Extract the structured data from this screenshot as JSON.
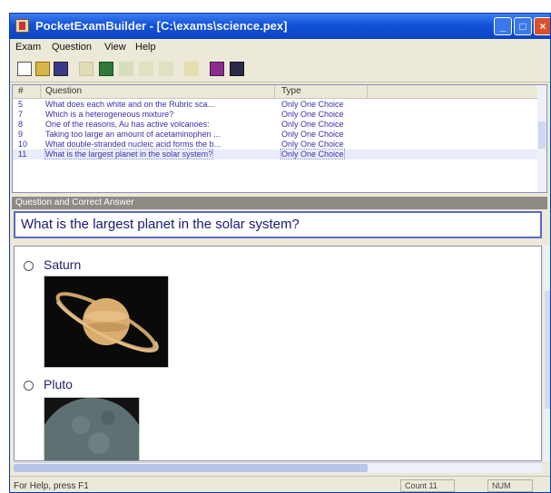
{
  "window": {
    "title": "PocketExamBuilder - [C:\\exams\\science.pex]",
    "controls": {
      "minimize": "_",
      "maximize": "□",
      "close": "×"
    }
  },
  "menu": [
    "Exam",
    "Question",
    "View",
    "Help"
  ],
  "toolbar": {
    "icons": [
      "new-icon",
      "open-icon",
      "save-icon",
      "cut-icon",
      "add-question-icon",
      "delete-question-icon",
      "move-up-icon",
      "move-down-icon",
      "edit-icon",
      "preview-icon",
      "help-icon"
    ]
  },
  "question_list": {
    "columns": [
      "#",
      "Question",
      "Type"
    ],
    "rows": [
      {
        "num": "5",
        "question": "What does each white and on the Rubric sca...",
        "type": "Only One Choice"
      },
      {
        "num": "7",
        "question": "Which is a heterogeneous mixture?",
        "type": "Only One Choice"
      },
      {
        "num": "8",
        "question": "One of the reasons, Au has active volcanoes:",
        "type": "Only One Choice"
      },
      {
        "num": "9",
        "question": "Taking too large an amount of acetaminophen ...",
        "type": "Only One Choice"
      },
      {
        "num": "10",
        "question": "What double-stranded nucleic acid forms the b...",
        "type": "Only One Choice"
      },
      {
        "num": "11",
        "question": "What is the largest planet in the solar system?",
        "type": "Only One Choice"
      }
    ]
  },
  "qa_panel": {
    "header": "Question and Correct Answer",
    "question": "What is the largest planet in the solar system?",
    "answers": [
      {
        "label": "Saturn"
      },
      {
        "label": "Pluto"
      }
    ]
  },
  "status": {
    "help": "For Help, press F1",
    "count": "Count 11",
    "num": "NUM"
  },
  "colors": {
    "titlebar": "#1352d6",
    "accent": "#5869c8",
    "window_bg": "#ece9d8"
  }
}
